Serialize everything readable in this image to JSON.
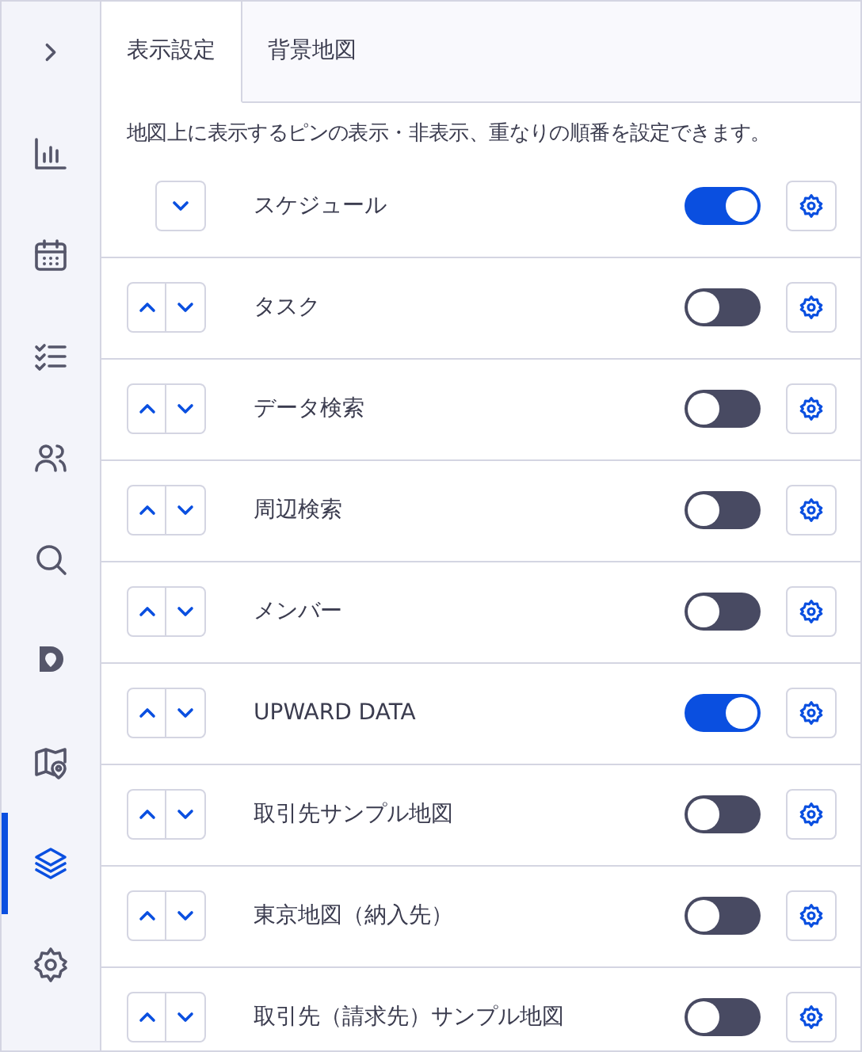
{
  "sidebar": {
    "items": [
      {
        "selected": false
      },
      {
        "selected": false
      },
      {
        "selected": false
      },
      {
        "selected": false
      },
      {
        "selected": false
      },
      {
        "selected": false
      },
      {
        "selected": false
      },
      {
        "selected": true
      },
      {
        "selected": false
      }
    ]
  },
  "tabs": [
    {
      "label": "表示設定",
      "selected": true
    },
    {
      "label": "背景地図",
      "selected": false
    }
  ],
  "description": "地図上に表示するピンの表示・非表示、重なりの順番を設定できます。",
  "layers": [
    {
      "label": "スケジュール",
      "can_move_up": false,
      "visible": true
    },
    {
      "label": "タスク",
      "can_move_up": true,
      "visible": false
    },
    {
      "label": "データ検索",
      "can_move_up": true,
      "visible": false
    },
    {
      "label": "周辺検索",
      "can_move_up": true,
      "visible": false
    },
    {
      "label": "メンバー",
      "can_move_up": true,
      "visible": false
    },
    {
      "label": "UPWARD DATA",
      "can_move_up": true,
      "visible": true
    },
    {
      "label": "取引先サンプル地図",
      "can_move_up": true,
      "visible": false
    },
    {
      "label": "東京地図（納入先）",
      "can_move_up": true,
      "visible": false
    },
    {
      "label": "取引先（請求先）サンプル地図",
      "can_move_up": true,
      "visible": false
    }
  ]
}
